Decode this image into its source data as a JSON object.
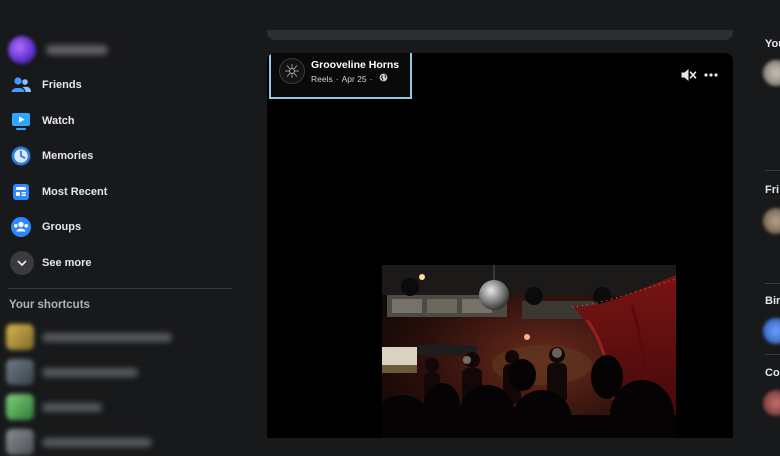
{
  "sidebar": {
    "items": [
      {
        "label": "Friends",
        "icon": "friends-icon"
      },
      {
        "label": "Watch",
        "icon": "watch-icon"
      },
      {
        "label": "Memories",
        "icon": "memories-icon"
      },
      {
        "label": "Most Recent",
        "icon": "most-recent-icon"
      },
      {
        "label": "Groups",
        "icon": "groups-icon"
      },
      {
        "label": "See more",
        "icon": "chevron-down-icon"
      }
    ],
    "shortcuts_title": "Your shortcuts"
  },
  "post": {
    "page_name": "Grooveline Horns",
    "source": "Reels",
    "separator": "·",
    "date": "Apr 25",
    "privacy_icon": "globe-icon",
    "controls": {
      "mute_icon": "muted-speaker-icon",
      "more_icon": "more-options-icon"
    }
  },
  "right_column": {
    "labels": [
      "You",
      "Fri",
      "Bir",
      "Co"
    ]
  },
  "colors": {
    "background": "#18191a",
    "feed_accent": "#2d88ff",
    "highlight_border": "#8fc9e4",
    "text_primary": "#e4e6eb",
    "text_secondary": "#b0b3b8"
  }
}
